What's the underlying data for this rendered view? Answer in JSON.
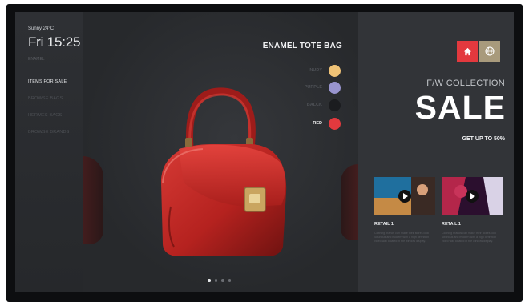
{
  "status": {
    "weather": "Sunny 24°C",
    "time": "Fri 15:25",
    "subtitle": "ENAMEL"
  },
  "menu": [
    {
      "label": "ITEMS FOR SALE",
      "active": true
    },
    {
      "label": "BROWSE BAGS",
      "active": false
    },
    {
      "label": "HERMES BAGS",
      "active": false
    },
    {
      "label": "BROWSE BRANDS",
      "active": false
    }
  ],
  "product": {
    "title": "ENAMEL TOTE BAG",
    "colors": [
      {
        "label": "NUDY",
        "hex": "#efc276",
        "active": false
      },
      {
        "label": "PURPLE",
        "hex": "#9995cf",
        "active": false
      },
      {
        "label": "BALCK",
        "hex": "#1b1c1f",
        "active": false
      },
      {
        "label": "RED",
        "hex": "#e3393e",
        "active": true
      }
    ],
    "bag_color": "#c32a27"
  },
  "carousel": {
    "pages": 4,
    "current": 1
  },
  "promo": {
    "home_icon": "home-icon",
    "globe_icon": "globe-icon",
    "collection": "F/W COLLECTION",
    "sale": "SALE",
    "offer": "GET UP TO 50%",
    "cards": [
      {
        "title": "RETAIL 1",
        "desc": "Clothing brands can make their stores look luxurious and modern with a high definition video wall located in the window display."
      },
      {
        "title": "RETAIL 1",
        "desc": "Clothing brands can make their stores look luxurious and modern with a high definition video wall located in the window display."
      }
    ]
  }
}
